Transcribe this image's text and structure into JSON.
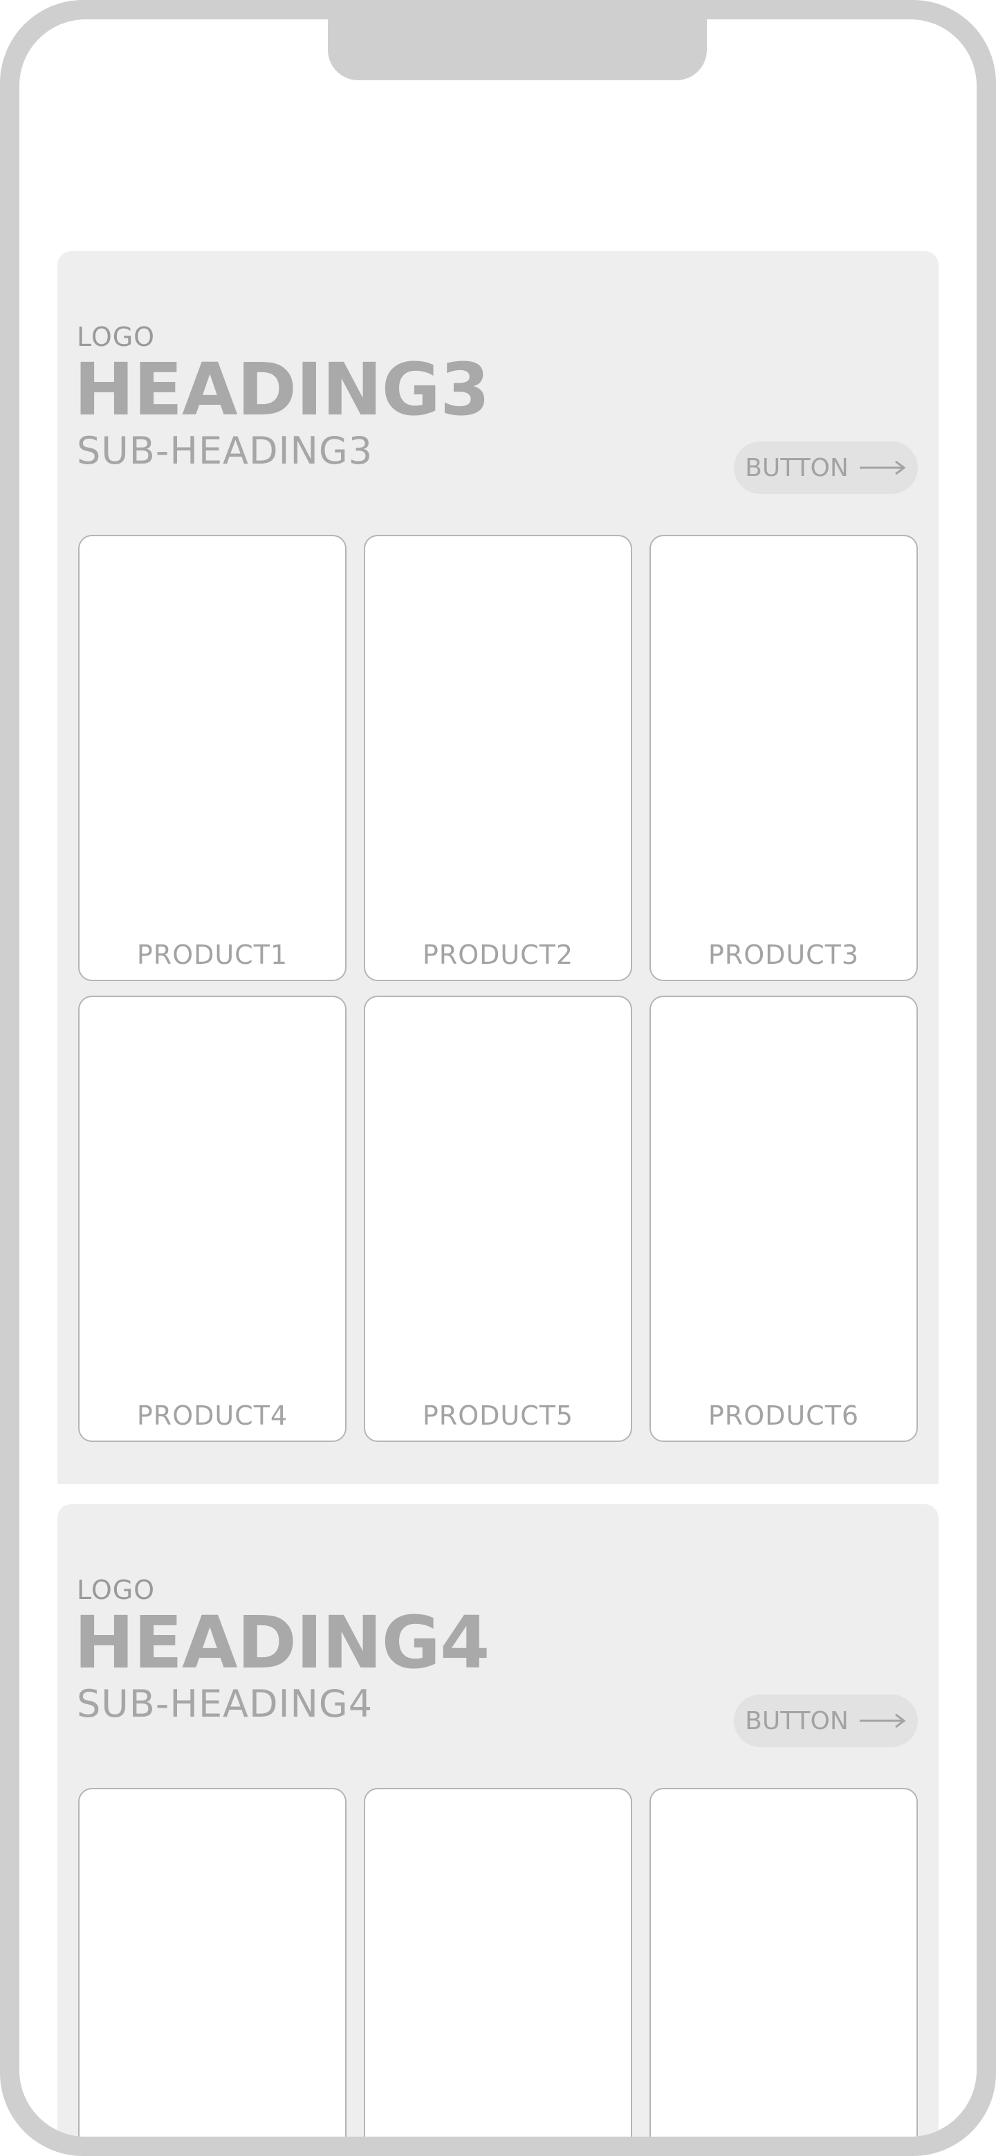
{
  "sections": [
    {
      "logo": "LOGO",
      "heading": "HEADING3",
      "subheading": "SUB-HEADING3",
      "button_label": "BUTTON",
      "products": [
        {
          "label": "PRODUCT1"
        },
        {
          "label": "PRODUCT2"
        },
        {
          "label": "PRODUCT3"
        },
        {
          "label": "PRODUCT4"
        },
        {
          "label": "PRODUCT5"
        },
        {
          "label": "PRODUCT6"
        }
      ]
    },
    {
      "logo": "LOGO",
      "heading": "HEADING4",
      "subheading": "SUB-HEADING4",
      "button_label": "BUTTON",
      "products": [
        {
          "label": ""
        },
        {
          "label": ""
        },
        {
          "label": ""
        }
      ]
    }
  ],
  "colors": {
    "frame": "#cfcfcf",
    "panel": "#eeeeee",
    "text": "#a9a9a9",
    "card_border": "#b5b5b5"
  },
  "icons": {
    "button_arrow": "arrow-right-icon"
  }
}
